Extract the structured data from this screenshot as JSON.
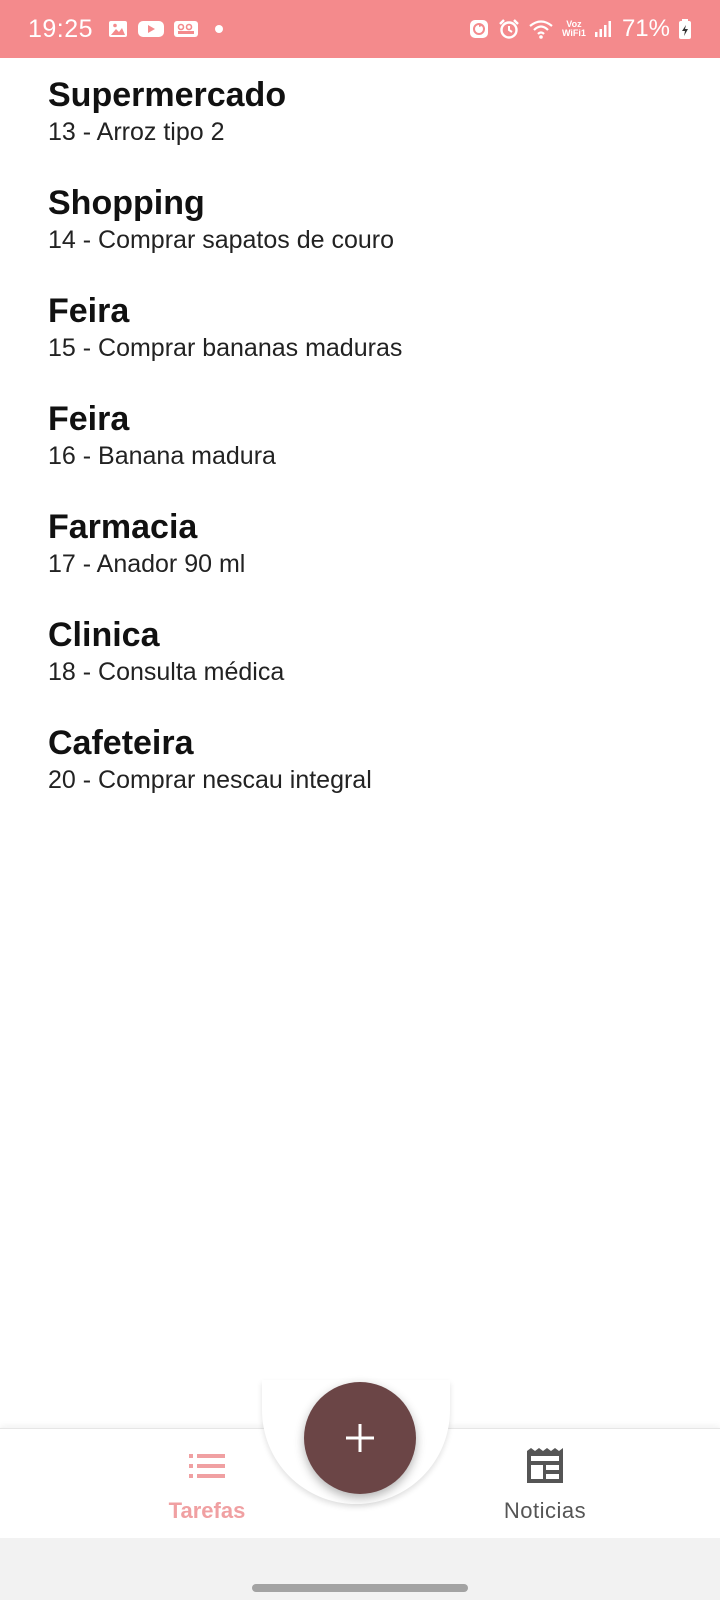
{
  "status_bar": {
    "time": "19:25",
    "voz_line1": "Voz",
    "voz_line2": "WiFi1",
    "battery": "71%",
    "icons": [
      "gallery-icon",
      "youtube-icon",
      "voicemail-icon",
      "notification-dot",
      "recycle-icon",
      "alarm-icon",
      "wifi-icon",
      "signal-icon",
      "battery-icon"
    ],
    "background": "#f48a8c"
  },
  "tasks": [
    {
      "title": "Supermercado",
      "subtitle": "13 - Arroz tipo 2"
    },
    {
      "title": "Shopping",
      "subtitle": "14 - Comprar sapatos de couro"
    },
    {
      "title": "Feira",
      "subtitle": "15 - Comprar bananas maduras"
    },
    {
      "title": "Feira",
      "subtitle": "16 - Banana madura"
    },
    {
      "title": "Farmacia",
      "subtitle": "17 - Anador 90 ml"
    },
    {
      "title": "Clinica",
      "subtitle": "18 - Consulta médica"
    },
    {
      "title": "Cafeteira",
      "subtitle": "20 - Comprar nescau integral"
    }
  ],
  "fab": {
    "icon": "plus-icon",
    "color": "#6b4546"
  },
  "bottom_nav": {
    "items": [
      {
        "label": "Tarefas",
        "icon": "list-icon",
        "active": true
      },
      {
        "label": "Noticias",
        "icon": "newspaper-icon",
        "active": false
      }
    ],
    "active_color": "#f0a0a2"
  }
}
